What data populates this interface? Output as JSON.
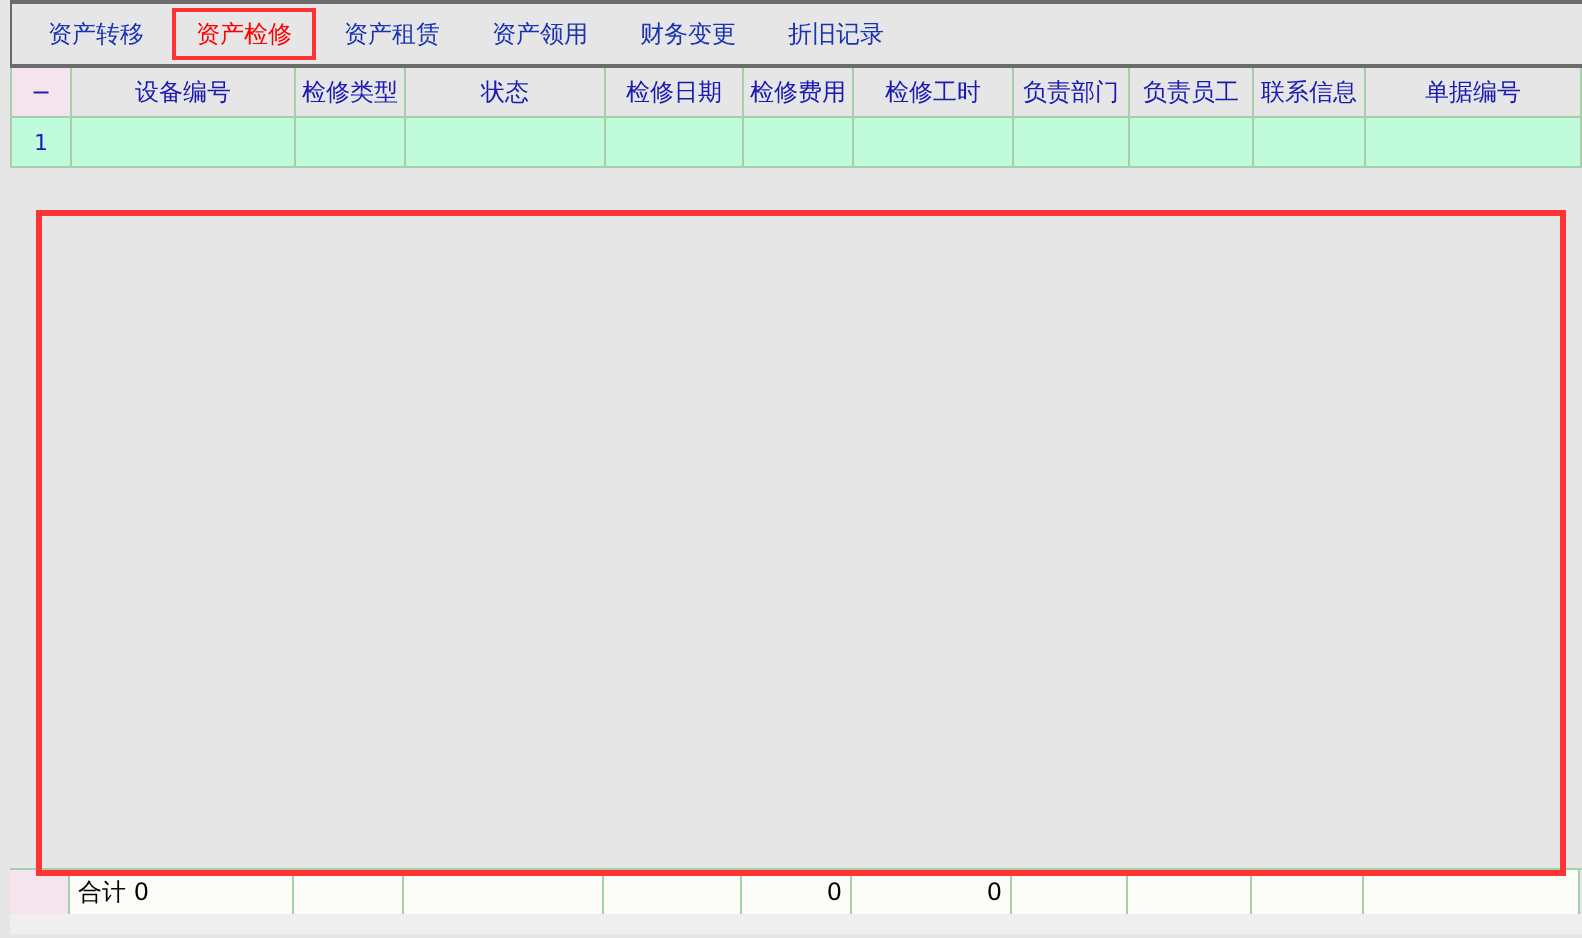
{
  "tabs": [
    {
      "label": "资产转移",
      "selected": false
    },
    {
      "label": "资产检修",
      "selected": true
    },
    {
      "label": "资产租赁",
      "selected": false
    },
    {
      "label": "资产领用",
      "selected": false
    },
    {
      "label": "财务变更",
      "selected": false
    },
    {
      "label": "折旧记录",
      "selected": false
    }
  ],
  "table": {
    "corner": "−",
    "columns": [
      "设备编号",
      "检修类型",
      "状态",
      "检修日期",
      "检修费用",
      "检修工时",
      "负责部门",
      "负责员工",
      "联系信息",
      "单据编号"
    ],
    "rows": [
      {
        "number": "1",
        "cells": [
          "",
          "",
          "",
          "",
          "",
          "",
          "",
          "",
          "",
          ""
        ]
      }
    ]
  },
  "footer": {
    "cells": [
      "合计 0",
      "",
      "",
      "",
      "0",
      "0",
      "",
      "",
      "",
      ""
    ]
  }
}
